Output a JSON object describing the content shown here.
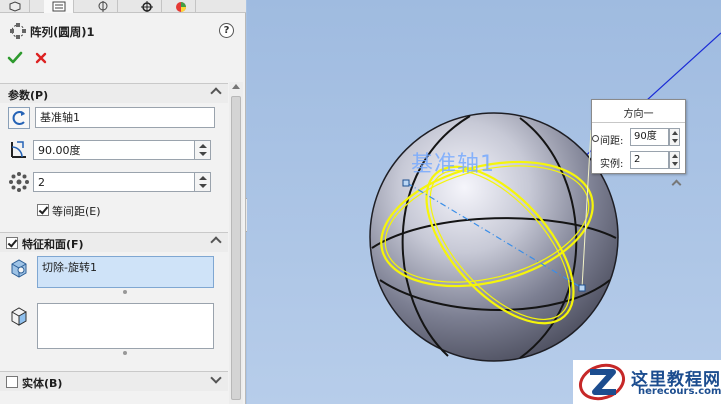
{
  "property_manager": {
    "title": "阵列(圆周)1",
    "help_label": "?"
  },
  "parameters": {
    "title": "参数(P)",
    "axis_value": "基准轴1",
    "angle_value": "90.00度",
    "count_value": "2",
    "equal_spacing_label": "等间距(E)",
    "equal_spacing_checked": true
  },
  "features": {
    "title": "特征和面(F)",
    "checked": true,
    "features_list": [
      "切除-旋转1"
    ],
    "faces_list": []
  },
  "bodies": {
    "title": "实体(B)",
    "checked": false
  },
  "viewport": {
    "axis_label": "基准轴1",
    "direction_box": {
      "title": "方向一",
      "spacing_label": "间距:",
      "spacing_value": "90度",
      "instances_label": "实例:",
      "instances_value": "2"
    }
  },
  "watermark": {
    "title": "这里教程网",
    "url": "herecours.com"
  },
  "colors": {
    "viewport_bg": "#a9c3e4",
    "axis_blue": "#1a2bd6",
    "highlight_yellow": "#f5f50a",
    "selection_blue": "#cfe3f8"
  }
}
